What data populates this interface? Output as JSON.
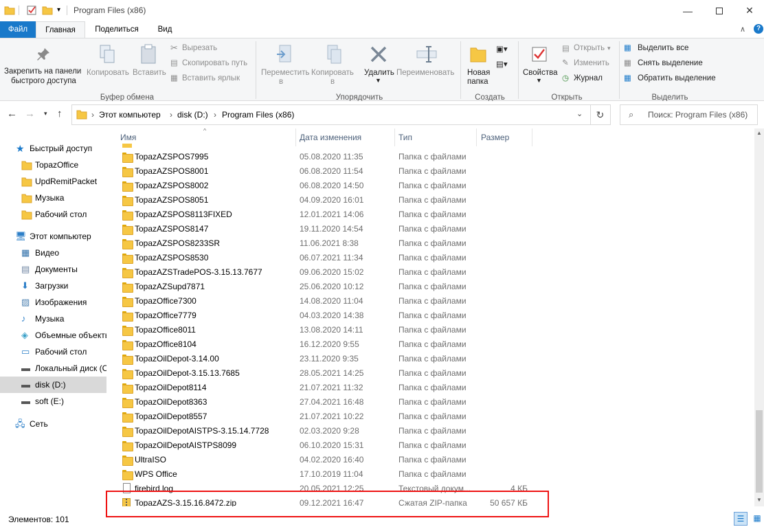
{
  "window": {
    "title": "Program Files (x86)"
  },
  "ribbon_tabs": [
    "Файл",
    "Главная",
    "Поделиться",
    "Вид"
  ],
  "ribbon": {
    "clipboard": {
      "pin": [
        "Закрепить на панели",
        "быстрого доступа"
      ],
      "copy": "Копировать",
      "paste": "Вставить",
      "cut": "Вырезать",
      "copy_path": "Скопировать путь",
      "paste_shortcut": "Вставить ярлык",
      "group": "Буфер обмена"
    },
    "organize": {
      "move_to": [
        "Переместить",
        "в"
      ],
      "copy_to": [
        "Копировать",
        "в"
      ],
      "delete": "Удалить",
      "rename": "Переименовать",
      "group": "Упорядочить"
    },
    "new": {
      "new_folder": [
        "Новая",
        "папка"
      ],
      "group": "Создать"
    },
    "open": {
      "properties": "Свойства",
      "open": "Открыть",
      "edit": "Изменить",
      "history": "Журнал",
      "group": "Открыть"
    },
    "select": {
      "select_all": "Выделить все",
      "select_none": "Снять выделение",
      "invert": "Обратить выделение",
      "group": "Выделить"
    }
  },
  "address": {
    "crumbs": [
      "Этот компьютер",
      "disk (D:)",
      "Program Files (x86)"
    ],
    "search_placeholder": "Поиск: Program Files (x86)"
  },
  "nav": {
    "quick_access": "Быстрый доступ",
    "quick_items": [
      "TopazOffice",
      "UpdRemitPacket",
      "Музыка",
      "Рабочий стол"
    ],
    "this_pc": "Этот компьютер",
    "pc_items": [
      "Видео",
      "Документы",
      "Загрузки",
      "Изображения",
      "Музыка",
      "Объемные объекты",
      "Рабочий стол",
      "Локальный диск (C:)",
      "disk (D:)",
      "soft (E:)"
    ],
    "network": "Сеть"
  },
  "columns": {
    "name": "Имя",
    "date": "Дата изменения",
    "type": "Тип",
    "size": "Размер"
  },
  "files": [
    {
      "name": "TopazAZSPOS7995",
      "date": "05.08.2020 11:35",
      "type": "Папка с файлами",
      "size": ""
    },
    {
      "name": "TopazAZSPOS8001",
      "date": "06.08.2020 11:54",
      "type": "Папка с файлами",
      "size": ""
    },
    {
      "name": "TopazAZSPOS8002",
      "date": "06.08.2020 14:50",
      "type": "Папка с файлами",
      "size": ""
    },
    {
      "name": "TopazAZSPOS8051",
      "date": "04.09.2020 16:01",
      "type": "Папка с файлами",
      "size": ""
    },
    {
      "name": "TopazAZSPOS8113FIXED",
      "date": "12.01.2021 14:06",
      "type": "Папка с файлами",
      "size": ""
    },
    {
      "name": "TopazAZSPOS8147",
      "date": "19.11.2020 14:54",
      "type": "Папка с файлами",
      "size": ""
    },
    {
      "name": "TopazAZSPOS8233SR",
      "date": "11.06.2021 8:38",
      "type": "Папка с файлами",
      "size": ""
    },
    {
      "name": "TopazAZSPOS8530",
      "date": "06.07.2021 11:34",
      "type": "Папка с файлами",
      "size": ""
    },
    {
      "name": "TopazAZSTradePOS-3.15.13.7677",
      "date": "09.06.2020 15:02",
      "type": "Папка с файлами",
      "size": ""
    },
    {
      "name": "TopazAZSupd7871",
      "date": "25.06.2020 10:12",
      "type": "Папка с файлами",
      "size": ""
    },
    {
      "name": "TopazOffice7300",
      "date": "14.08.2020 11:04",
      "type": "Папка с файлами",
      "size": ""
    },
    {
      "name": "TopazOffice7779",
      "date": "04.03.2020 14:38",
      "type": "Папка с файлами",
      "size": ""
    },
    {
      "name": "TopazOffice8011",
      "date": "13.08.2020 14:11",
      "type": "Папка с файлами",
      "size": ""
    },
    {
      "name": "TopazOffice8104",
      "date": "16.12.2020 9:55",
      "type": "Папка с файлами",
      "size": ""
    },
    {
      "name": "TopazOilDepot-3.14.00",
      "date": "23.11.2020 9:35",
      "type": "Папка с файлами",
      "size": ""
    },
    {
      "name": "TopazOilDepot-3.15.13.7685",
      "date": "28.05.2021 14:25",
      "type": "Папка с файлами",
      "size": ""
    },
    {
      "name": "TopazOilDepot8114",
      "date": "21.07.2021 11:32",
      "type": "Папка с файлами",
      "size": ""
    },
    {
      "name": "TopazOilDepot8363",
      "date": "27.04.2021 16:48",
      "type": "Папка с файлами",
      "size": ""
    },
    {
      "name": "TopazOilDepot8557",
      "date": "21.07.2021 10:22",
      "type": "Папка с файлами",
      "size": ""
    },
    {
      "name": "TopazOilDepotAISTPS-3.15.14.7728",
      "date": "02.03.2020 9:28",
      "type": "Папка с файлами",
      "size": ""
    },
    {
      "name": "TopazOilDepotAISTPS8099",
      "date": "06.10.2020 15:31",
      "type": "Папка с файлами",
      "size": ""
    },
    {
      "name": "UltraISO",
      "date": "04.02.2020 16:40",
      "type": "Папка с файлами",
      "size": ""
    },
    {
      "name": "WPS Office",
      "date": "17.10.2019 11:04",
      "type": "Папка с файлами",
      "size": ""
    },
    {
      "name": "firebird.log",
      "date": "20.05.2021 12:25",
      "type": "Текстовый докум...",
      "size": "4 КБ"
    },
    {
      "name": "TopazAZS-3.15.16.8472.zip",
      "date": "09.12.2021 16:47",
      "type": "Сжатая ZIP-папка",
      "size": "50 657 КБ"
    }
  ],
  "status": {
    "items_count": "Элементов: 101"
  },
  "colors": {
    "file_tab": "#1979ca",
    "highlight_box": "#e11111"
  }
}
